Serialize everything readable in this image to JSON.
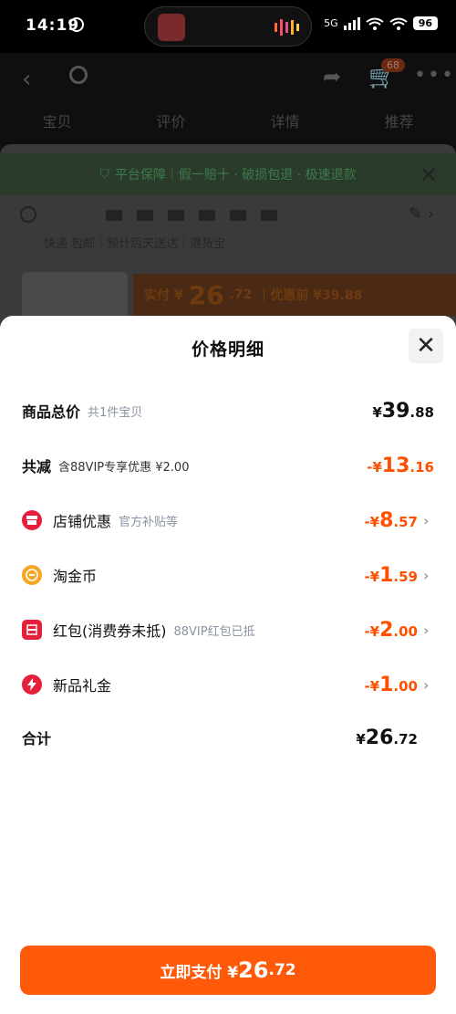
{
  "status": {
    "time": "14:19",
    "network": "5G",
    "battery": "96"
  },
  "nav": {
    "cart_badge": "68"
  },
  "tabs": [
    "宝贝",
    "评价",
    "详情",
    "推荐"
  ],
  "guarantee": {
    "text": "平台保障｜假一赔十 · 破损包退 · 极速退款"
  },
  "shipping": {
    "text": "快递 包邮｜预计后天送达｜退货宝"
  },
  "price_bar": {
    "prefix": "实付 ¥",
    "amount_int": "26",
    "amount_dec": ".72",
    "before_label": "｜优惠前 ¥39.88"
  },
  "detail": {
    "title": "价格明细",
    "rows": [
      {
        "label": "商品总价",
        "sub": "共1件宝贝",
        "value_prefix": "¥",
        "value_int": "39",
        "value_dec": ".88"
      },
      {
        "label": "共减",
        "sub": "含88VIP专享优惠 ¥2.00",
        "value_prefix": "-¥",
        "value_int": "13",
        "value_dec": ".16"
      },
      {
        "label": "店铺优惠",
        "sub": "官方补贴等",
        "value_prefix": "-¥",
        "value_int": "8",
        "value_dec": ".57",
        "icon": "store-icon"
      },
      {
        "label": "淘金币",
        "sub": "",
        "value_prefix": "-¥",
        "value_int": "1",
        "value_dec": ".59",
        "icon": "coin-icon"
      },
      {
        "label": "红包(消费券未抵)",
        "sub": "88VIP红包已抵",
        "value_prefix": "-¥",
        "value_int": "2",
        "value_dec": ".00",
        "icon": "red-packet-icon"
      },
      {
        "label": "新品礼金",
        "sub": "",
        "value_prefix": "-¥",
        "value_int": "1",
        "value_dec": ".00",
        "icon": "lightning-icon"
      },
      {
        "label": "合计",
        "sub": "",
        "value_prefix": "¥",
        "value_int": "26",
        "value_dec": ".72"
      }
    ]
  },
  "pay": {
    "label": "立即支付 ¥",
    "amount_int": "26",
    "amount_dec": ".72"
  },
  "colors": {
    "accent": "#ff5000",
    "icon_red": "#e61f3a",
    "icon_gold": "#f5a623"
  }
}
